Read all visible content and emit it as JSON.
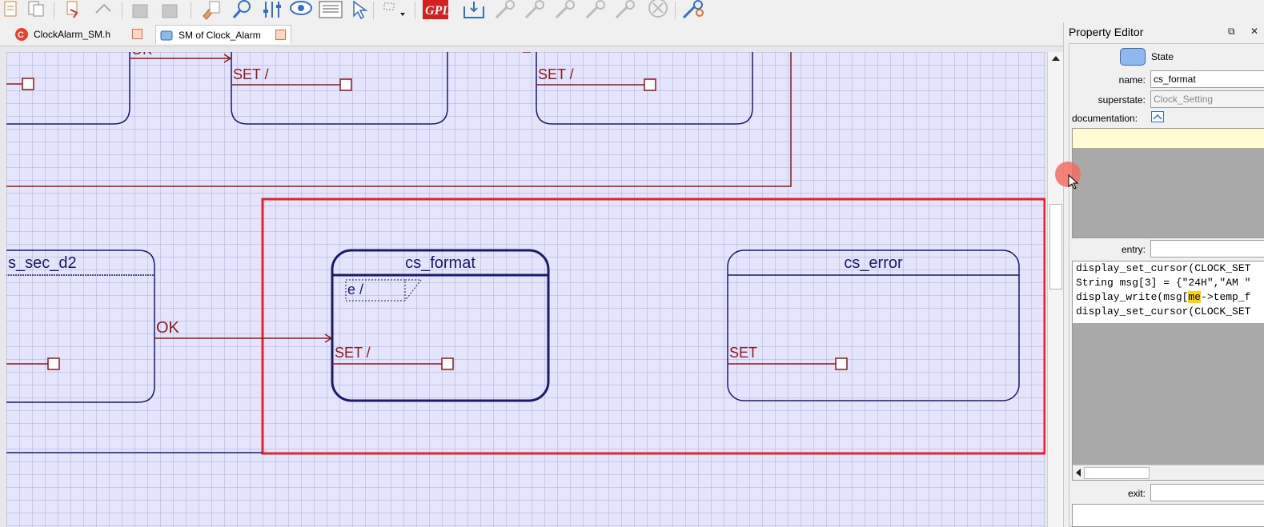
{
  "tabs": [
    {
      "label": "ClockAlarm_SM.h",
      "icon": "c-file-icon"
    },
    {
      "label": "SM of Clock_Alarm",
      "icon": "state-machine-icon"
    }
  ],
  "toolbar": {
    "gpl_label": "GPL",
    "icons": [
      "new-file-icon",
      "copy-file-icon",
      "link-icon",
      "unlink-icon",
      "disabled-icon",
      "disabled-icon",
      "edit-icon",
      "search-icon",
      "sliders-icon",
      "eye-icon",
      "list-icon",
      "pointer-icon",
      "grid-dropdown-icon",
      "gpl-icon",
      "import-icon",
      "wrench-icon",
      "wrench-icon",
      "wrench-icon",
      "wrench-icon",
      "wrench-icon",
      "cancel-icon",
      "settings-wrench-icon"
    ]
  },
  "diagram": {
    "states": [
      {
        "name": "s_sec_d2"
      },
      {
        "name": "cs_format",
        "entry_label": "e /",
        "transition_label": "SET /"
      },
      {
        "name": "cs_error",
        "transition_label": "SET"
      }
    ],
    "top_labels": [
      "OK",
      "SET /",
      "SET /"
    ],
    "ok_label": "OK"
  },
  "property_editor": {
    "title": "Property Editor",
    "kind_label": "State",
    "name_label": "name:",
    "name_value": "cs_format",
    "superstate_label": "superstate:",
    "superstate_value": "Clock_Setting",
    "documentation_label": "documentation:",
    "entry_label": "entry:",
    "exit_label": "exit:",
    "entry_code": [
      "display_set_cursor(CLOCK_SET",
      "String msg[3] = {\"24H\",\"AM \"",
      "display_write(msg[me->temp_f",
      "display_set_cursor(CLOCK_SET"
    ],
    "highlight_token": "me"
  },
  "colors": {
    "state_border": "#1a1a6e",
    "transition": "#8b1a1a",
    "selection": "#e8202a",
    "canvas": "#e4e4fd"
  }
}
